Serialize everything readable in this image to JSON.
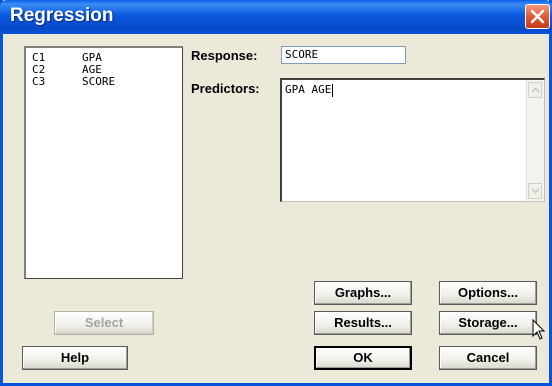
{
  "window": {
    "title": "Regression"
  },
  "variables": [
    {
      "col": "C1",
      "name": "GPA"
    },
    {
      "col": "C2",
      "name": "AGE"
    },
    {
      "col": "C3",
      "name": "SCORE"
    }
  ],
  "response": {
    "label": "Response:",
    "value": "SCORE"
  },
  "predictors": {
    "label": "Predictors:",
    "value": "GPA AGE"
  },
  "buttons": {
    "graphs": "Graphs...",
    "options": "Options...",
    "select": "Select",
    "results": "Results...",
    "storage": "Storage...",
    "help": "Help",
    "ok": "OK",
    "cancel": "Cancel"
  },
  "colors": {
    "titlebar": "#0855dd",
    "dialog_bg": "#ece9d8",
    "close": "#e0542f"
  }
}
